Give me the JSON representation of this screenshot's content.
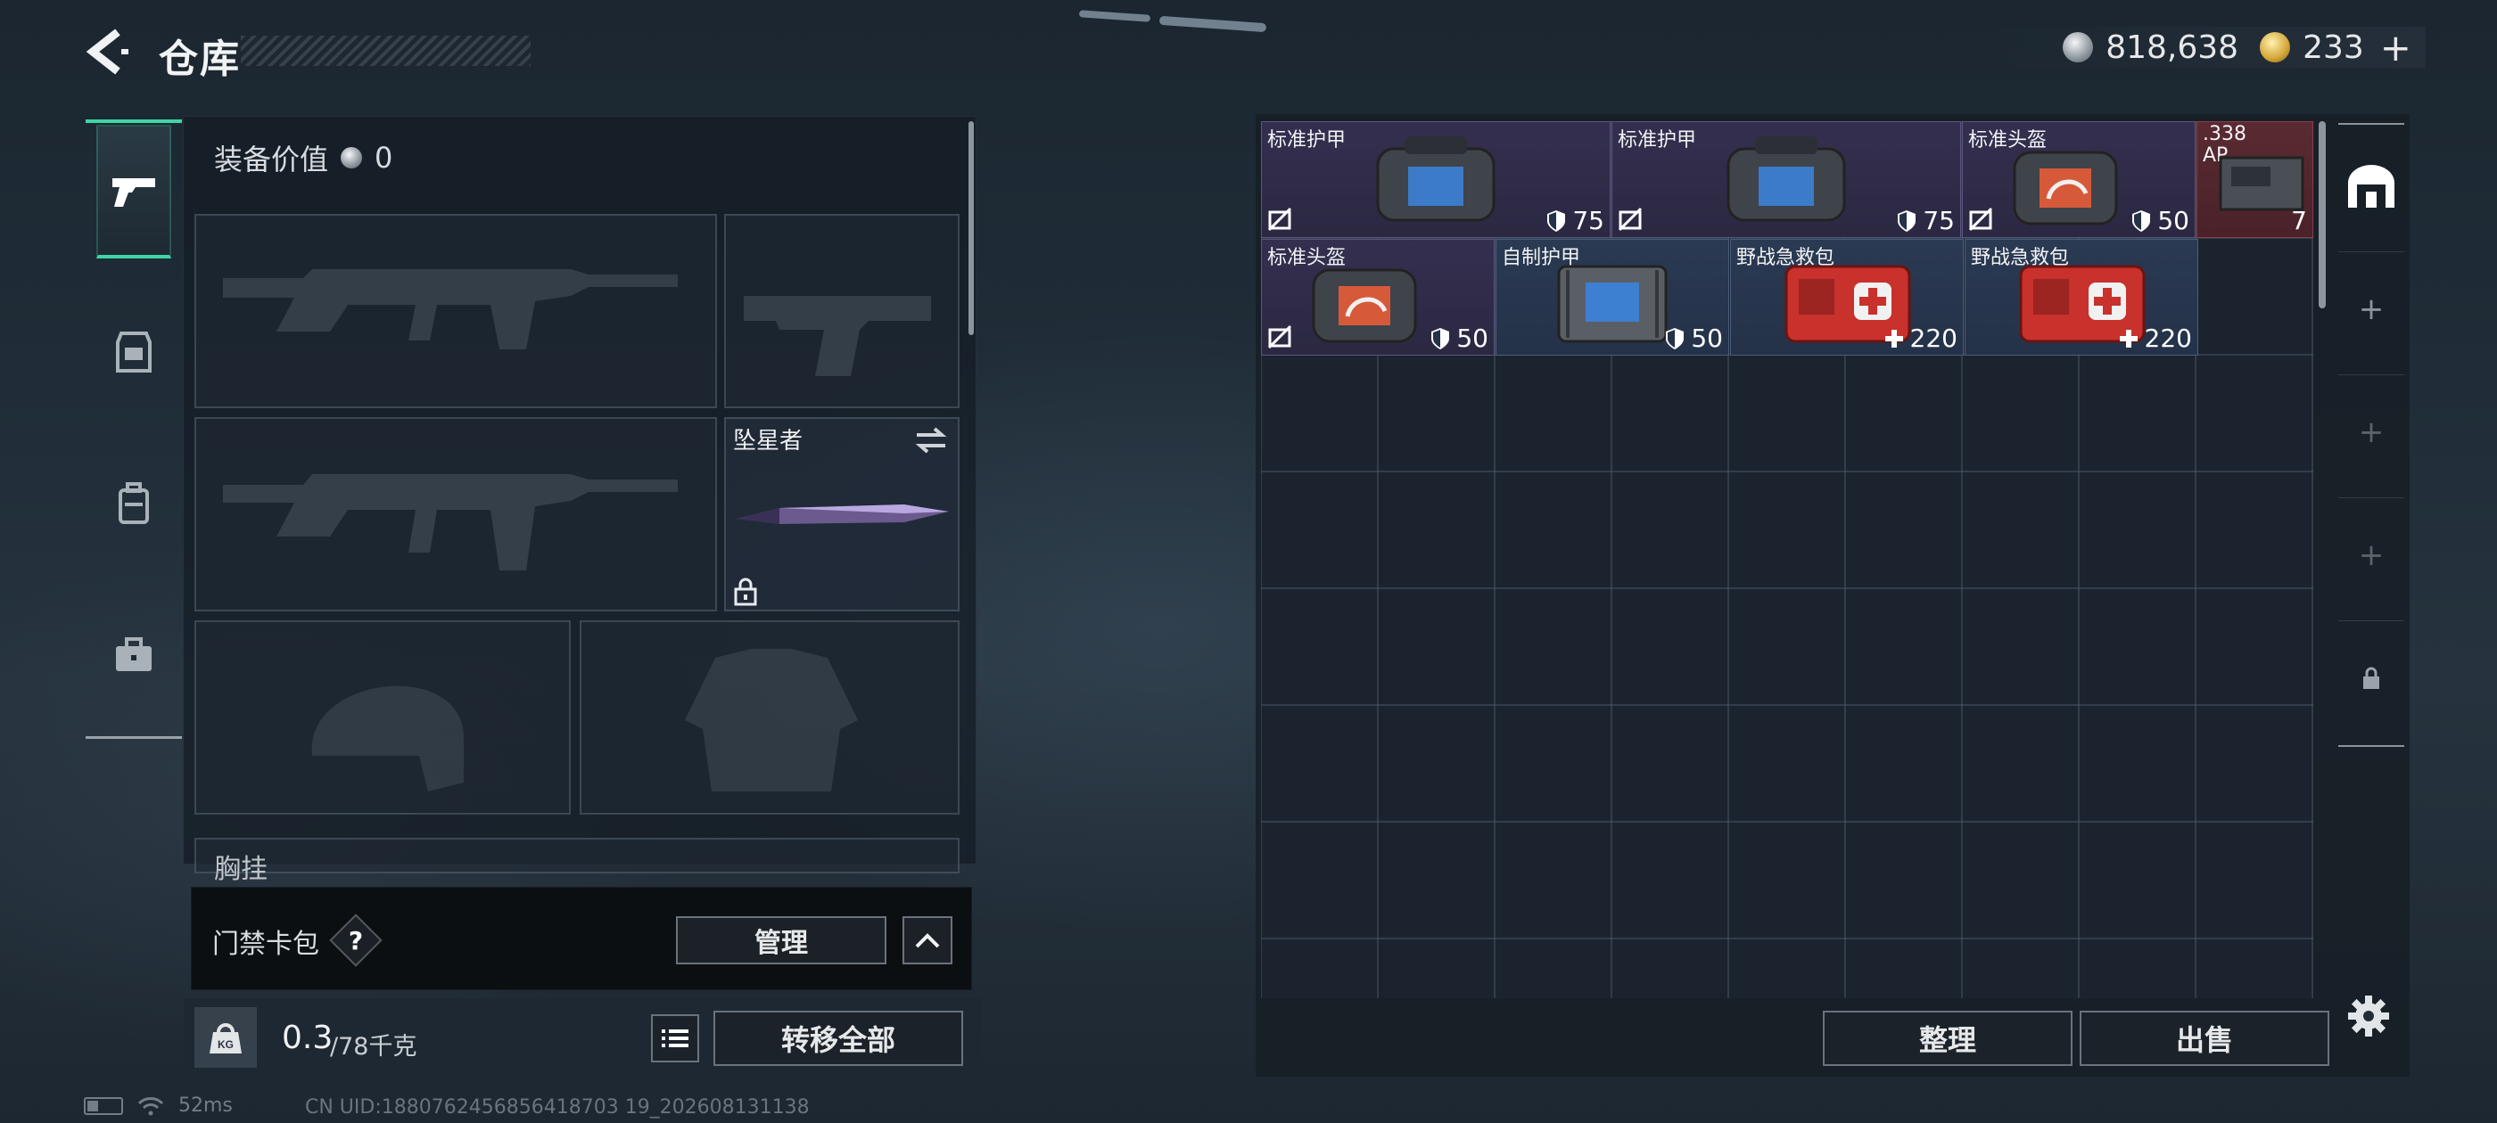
{
  "header": {
    "title": "仓库",
    "silver_amount": "818,638",
    "gold_amount": "233",
    "add_symbol": "+"
  },
  "sidebar": {
    "tabs": [
      {
        "icon": "pistol-icon",
        "active": true
      },
      {
        "icon": "armor-icon",
        "active": false
      },
      {
        "icon": "backpack-icon",
        "active": false
      },
      {
        "icon": "briefcase-icon",
        "active": false
      }
    ]
  },
  "loadout": {
    "gear_value_label": "装备价值",
    "gear_value": "0",
    "melee_name": "坠星者",
    "chest_label": "胸挂",
    "keycard_label": "门禁卡包",
    "keycard_help": "?",
    "manage_label": "管理"
  },
  "weight": {
    "current": "0.3",
    "max": "/78千克",
    "icon_text": "KG"
  },
  "buttons": {
    "transfer_all": "转移全部",
    "sort": "整理",
    "sell": "出售"
  },
  "storage": {
    "items": [
      {
        "name": "标准护甲",
        "value": "75",
        "value_icon": "shield-icon",
        "rarity": "purple",
        "broken": true
      },
      {
        "name": "标准护甲",
        "value": "75",
        "value_icon": "shield-icon",
        "rarity": "purple",
        "broken": true
      },
      {
        "name": "标准头盔",
        "value": "50",
        "value_icon": "shield-icon",
        "rarity": "purple",
        "broken": true
      },
      {
        "name": ".338 AP",
        "value": "7",
        "rarity": "red"
      },
      {
        "name": "标准头盔",
        "value": "50",
        "value_icon": "shield-icon",
        "rarity": "purple",
        "broken": true
      },
      {
        "name": "自制护甲",
        "value": "50",
        "value_icon": "shield-icon",
        "rarity": "blue"
      },
      {
        "name": "野战急救包",
        "value": "220",
        "value_icon": "plus-icon",
        "rarity": "blue"
      },
      {
        "name": "野战急救包",
        "value": "220",
        "value_icon": "plus-icon",
        "rarity": "blue"
      }
    ]
  },
  "status": {
    "ping": "52ms",
    "uid": "CN UID:1880762456856418703 19_202608131138"
  },
  "colors": {
    "accent": "#3fd6a6",
    "rarity_purple": "#342f4f",
    "rarity_blue": "#2a3a52",
    "rarity_red": "#5a2a32"
  }
}
